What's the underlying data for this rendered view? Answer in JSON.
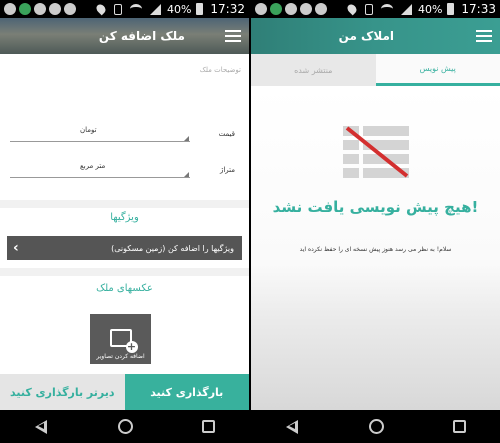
{
  "status_bar": {
    "battery_pct": "40%",
    "time": "17:32",
    "time_right": "17:33"
  },
  "left": {
    "appbar_title": "ملک اضافه کن",
    "description_placeholder": "توضیحات ملک",
    "price_label": "قیمت",
    "price_unit": "تومان",
    "area_label": "متراژ",
    "area_unit": "متر مربع",
    "features_title": "ویژگیها",
    "features_button": "ویژگیها را اضافه کن (زمین مسکونی)",
    "photos_title": "عکسهای ملک",
    "add_images_label": "اضافه کردن تصاویر",
    "draft_button": "دیرتر بارگذاری کنید",
    "upload_button": "بارگذاری کنید"
  },
  "right": {
    "appbar_title": "املاک من",
    "tab_drafts": "پیش نویس",
    "tab_published": "منتشر شده",
    "empty_title": "هیچ پیش نویسی یافت نشد!",
    "empty_message": "سلام! به نظر می رسد هنوز پیش نسخه ای را حفظ نکرده اید"
  },
  "colors": {
    "accent": "#36b09f",
    "upload_button": "#38b19d",
    "feature_bar": "#555555",
    "cross_line": "#d32f2f"
  },
  "icons": [
    "menu-icon",
    "add-image-icon",
    "chevron-left-icon",
    "empty-list-icon",
    "back-icon",
    "home-icon",
    "recent-apps-icon"
  ]
}
